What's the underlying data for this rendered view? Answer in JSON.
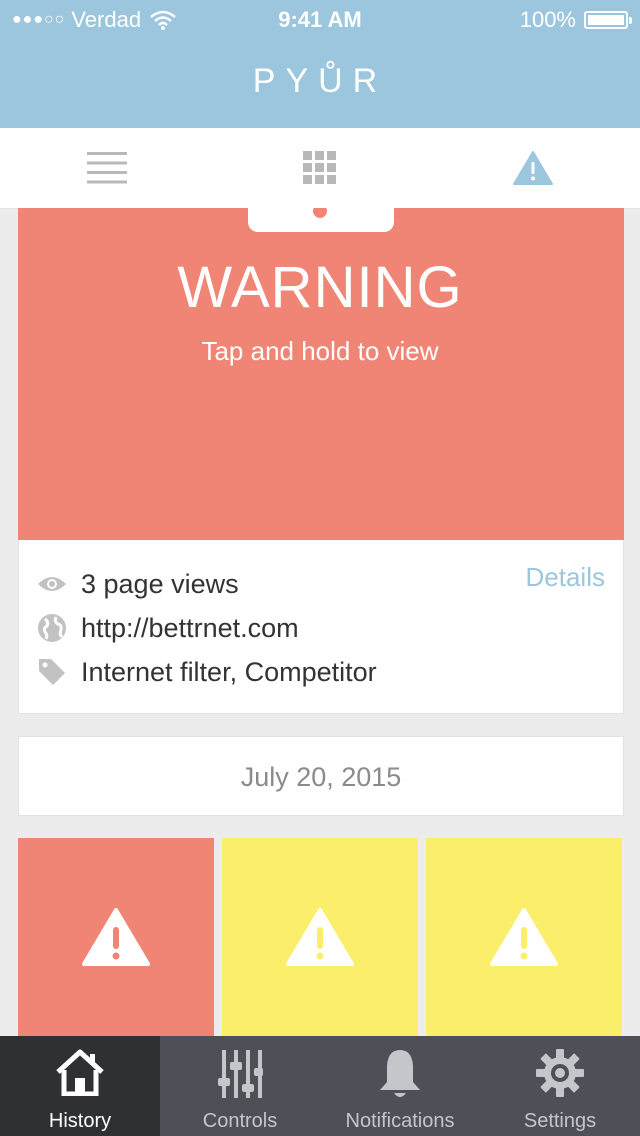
{
  "status_bar": {
    "signal_dots": "●●●○○",
    "carrier": "Verdad",
    "time": "9:41 AM",
    "battery": "100%",
    "battery_level": 1.0
  },
  "header": {
    "brand": "PYŮR"
  },
  "view_switcher": {
    "icons": [
      "list-icon",
      "grid-icon",
      "warning-icon"
    ],
    "active": "warning-icon"
  },
  "warning": {
    "title": "WARNING",
    "subtitle": "Tap and hold to view"
  },
  "details": {
    "views": "3 page views",
    "details_link": "Details",
    "url": "http://bettrnet.com",
    "tags": "Internet filter, Competitor"
  },
  "date": "July 20, 2015",
  "tiles": [
    {
      "color": "#f08575",
      "icon": "warning-icon"
    },
    {
      "color": "#fbee6b",
      "icon": "warning-icon"
    },
    {
      "color": "#fbee6b",
      "icon": "warning-icon"
    }
  ],
  "tabbar": {
    "tabs": [
      {
        "label": "History",
        "icon": "home-icon"
      },
      {
        "label": "Controls",
        "icon": "sliders-icon"
      },
      {
        "label": "Notifications",
        "icon": "bell-icon"
      },
      {
        "label": "Settings",
        "icon": "gear-icon"
      }
    ],
    "active": "History"
  },
  "colors": {
    "accent": "#9cc6dd",
    "warning_red": "#f08575",
    "caution_yellow": "#fbee6b",
    "tabbar": "#4d5056"
  }
}
